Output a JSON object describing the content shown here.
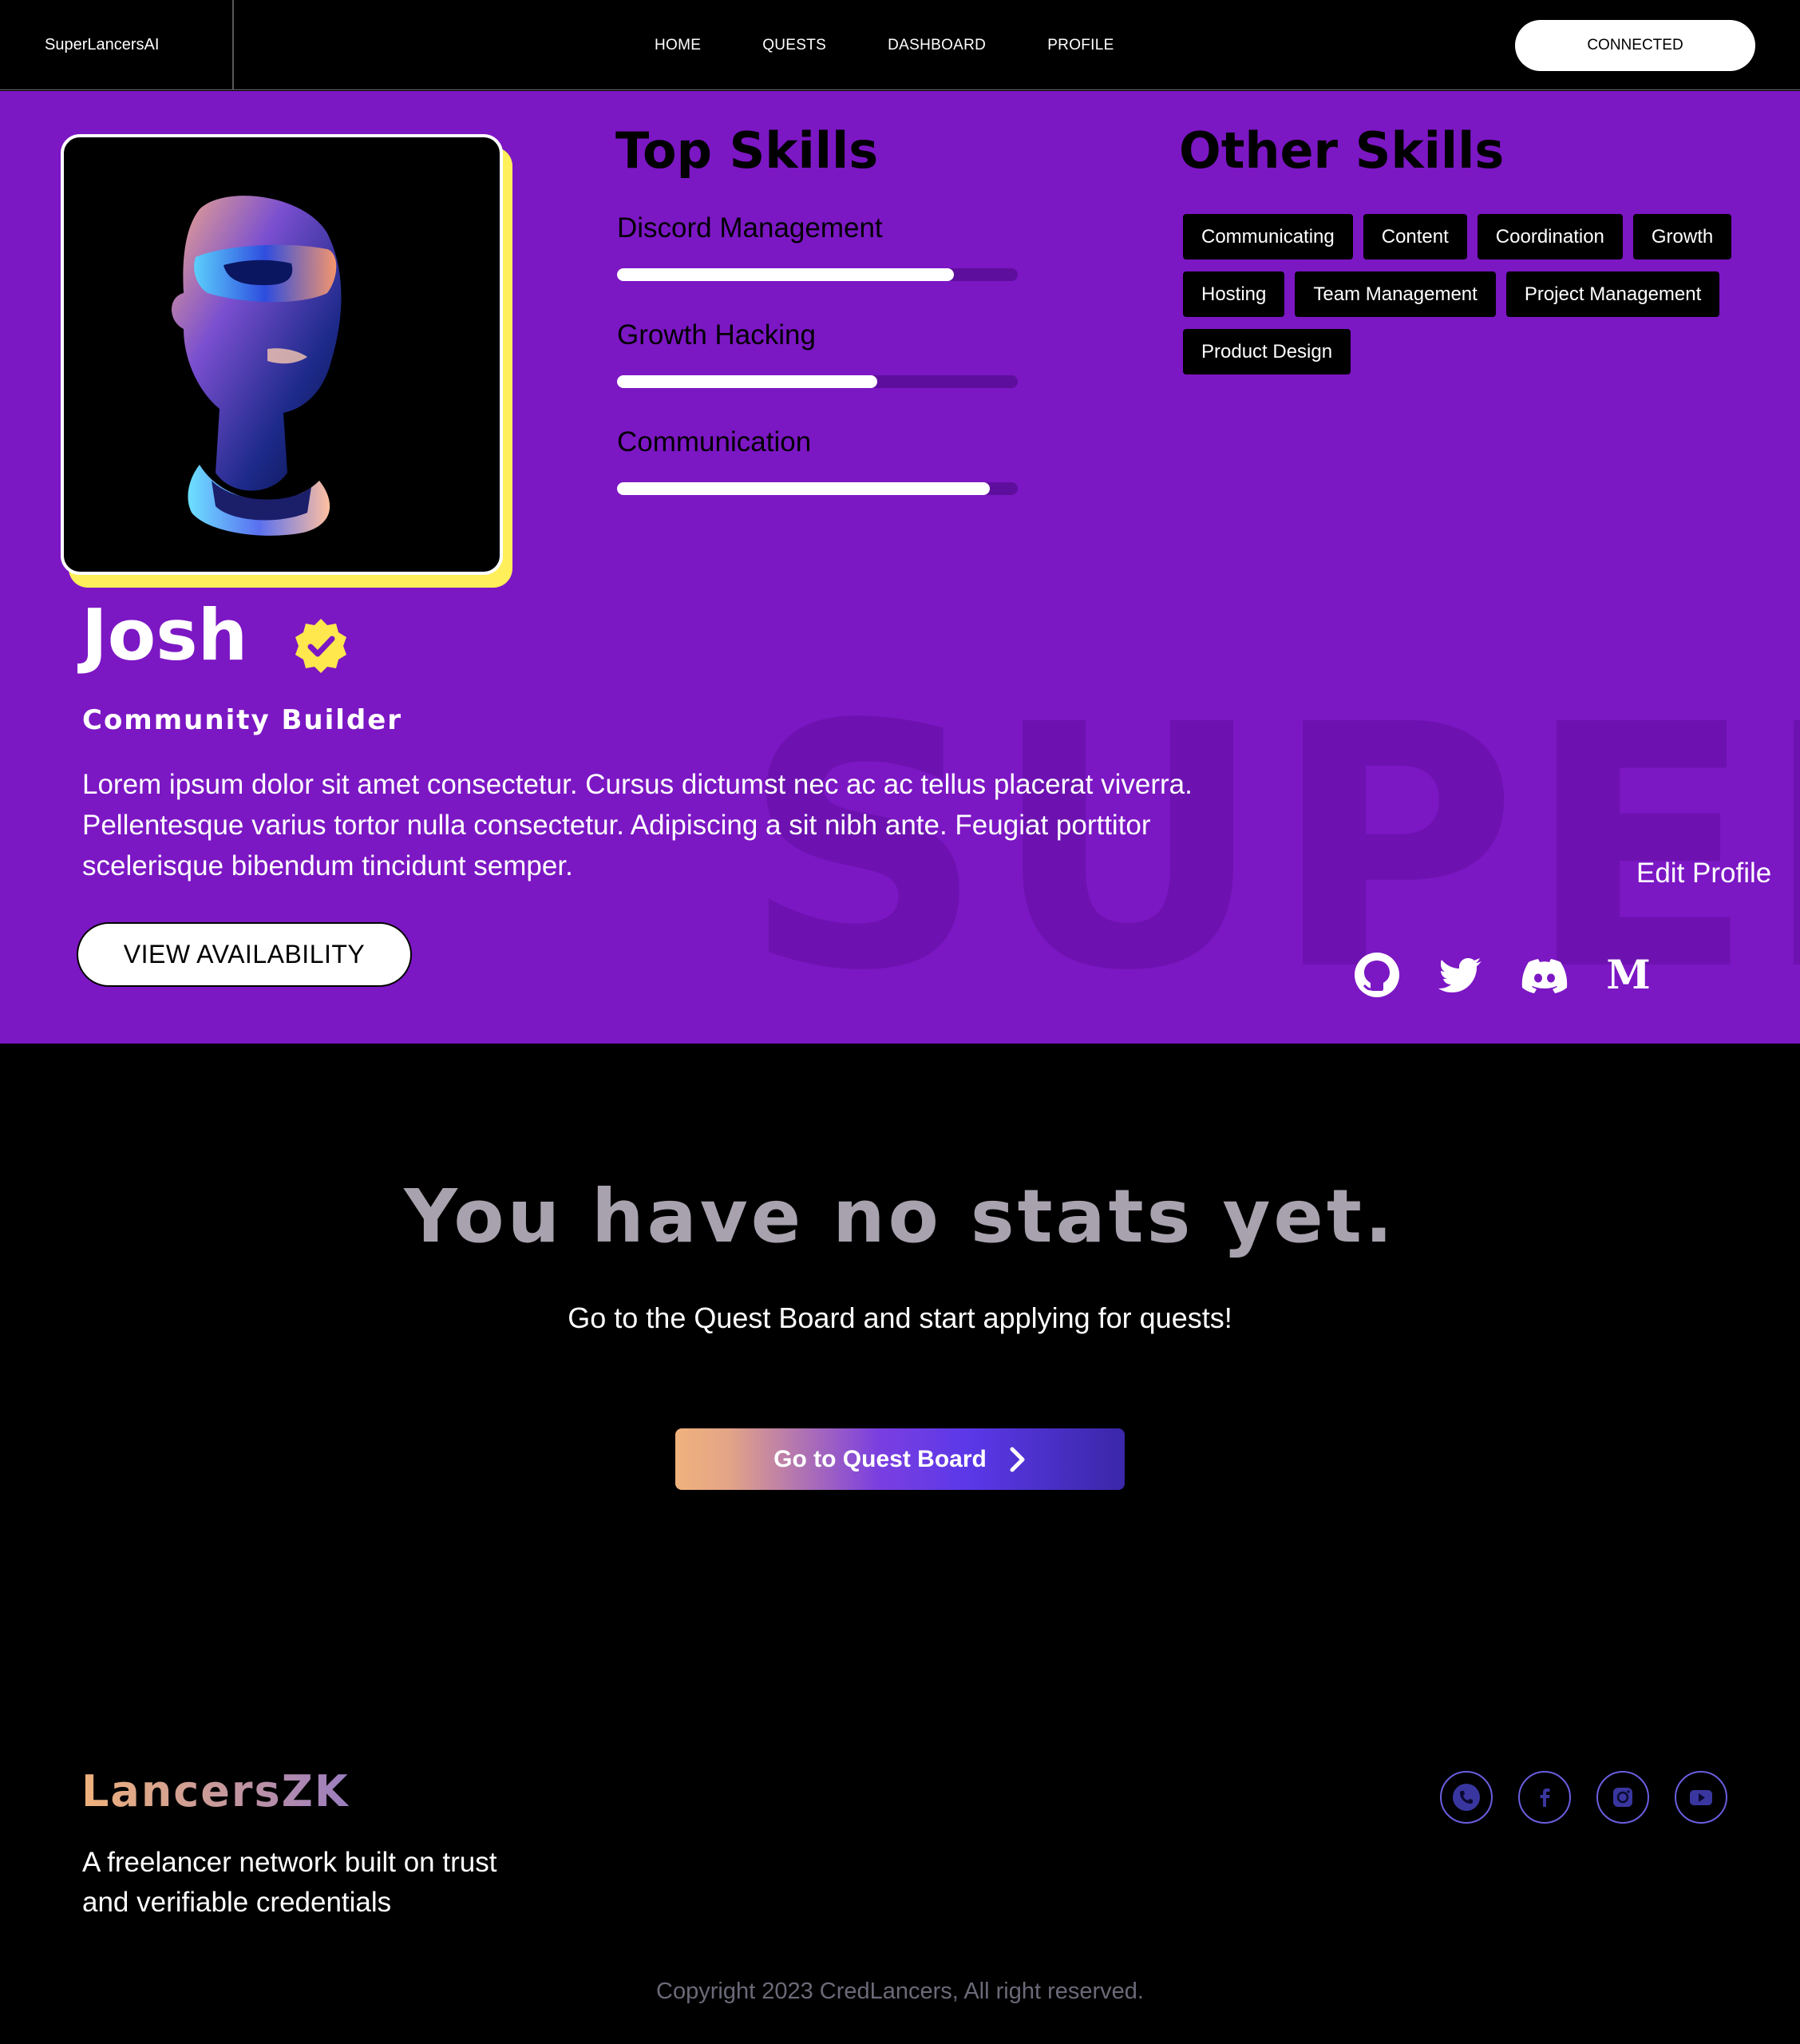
{
  "nav": {
    "brand": "SuperLancersAI",
    "links": [
      "HOME",
      "QUESTS",
      "DASHBOARD",
      "PROFILE"
    ],
    "connect_label": "CONNECTED"
  },
  "profile": {
    "name": "Josh",
    "role": "Community Builder",
    "bio": "Lorem ipsum dolor sit amet consectetur. Cursus dictumst nec ac ac tellus placerat viverra. Pellentesque varius tortor nulla consectetur. Adipiscing a sit nibh ante. Feugiat porttitor scelerisque bibendum tincidunt semper.",
    "availability_label": "VIEW AVAILABILITY",
    "edit_label": "Edit Profile",
    "background_word": "SUPER",
    "social_icons": [
      "github-icon",
      "twitter-icon",
      "discord-icon",
      "medium-icon"
    ],
    "accent_color": "#7c17c4",
    "avatar_frame_color": "#ffef5a"
  },
  "top_skills": {
    "title": "Top Skills",
    "items": [
      {
        "label": "Discord Management",
        "level": 0.84
      },
      {
        "label": "Growth Hacking",
        "level": 0.65
      },
      {
        "label": "Communication",
        "level": 0.93
      }
    ]
  },
  "other_skills": {
    "title": "Other Skills",
    "items": [
      "Communicating",
      "Content",
      "Coordination",
      "Growth",
      "Hosting",
      "Team Management",
      "Project Management",
      "Product Design"
    ]
  },
  "stats": {
    "title": "You have no stats yet.",
    "subtitle": "Go to the Quest Board and start applying for quests!",
    "button_label": "Go to Quest Board"
  },
  "footer": {
    "logo": "LancersZK",
    "tagline": "A freelancer network built on trust and verifiable credentials",
    "social_icons": [
      "phone-icon",
      "facebook-icon",
      "instagram-icon",
      "youtube-icon"
    ],
    "copyright": "Copyright 2023 CredLancers, All right reserved."
  }
}
